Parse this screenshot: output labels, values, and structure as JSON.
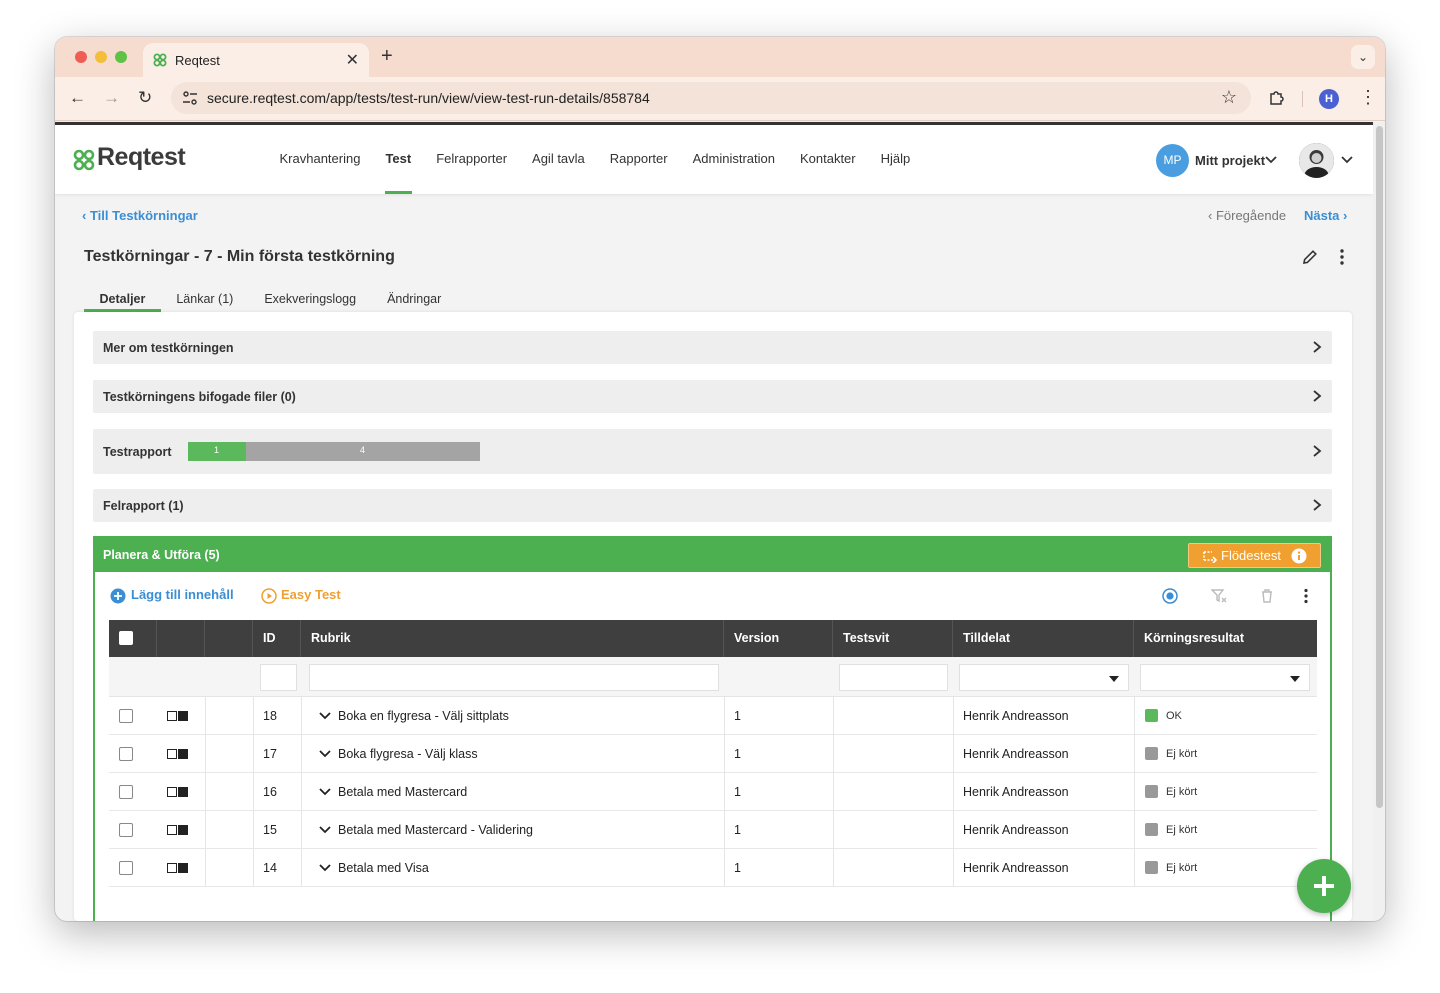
{
  "browser": {
    "tab_title": "Reqtest",
    "url": "secure.reqtest.com/app/tests/test-run/view/view-test-run-details/858784",
    "profile_initial": "H"
  },
  "app": {
    "logo_text": "Reqtest",
    "nav": [
      "Kravhantering",
      "Test",
      "Felrapporter",
      "Agil tavla",
      "Rapporter",
      "Administration",
      "Kontakter",
      "Hjälp"
    ],
    "active_nav": "Test",
    "project_initials": "MP",
    "project_label": "Mitt projekt"
  },
  "crumbs": {
    "back": "Till Testkörningar",
    "prev": "Föregående",
    "next": "Nästa"
  },
  "page": {
    "title": "Testkörningar - 7 - Min första testkörning",
    "subtabs": [
      "Detaljer",
      "Länkar (1)",
      "Exekveringslogg",
      "Ändringar"
    ],
    "active_subtab": "Detaljer"
  },
  "sections": {
    "more": "Mer om testkörningen",
    "files": "Testkörningens bifogade filer (0)",
    "report": "Testrapport",
    "report_pass": "1",
    "report_rest": "4",
    "report_pass_fraction": 0.2,
    "bugs": "Felrapport (1)"
  },
  "plan": {
    "title": "Planera & Utföra (5)",
    "flow_button": "Flödestest",
    "add_content": "Lägg till innehåll",
    "easy_test": "Easy Test",
    "columns": [
      "ID",
      "Rubrik",
      "Version",
      "Testsvit",
      "Tilldelat",
      "Körningsresultat"
    ],
    "rows": [
      {
        "id": "18",
        "title": "Boka en flygresa - Välj sittplats",
        "version": "1",
        "suite": "",
        "assignee": "Henrik Andreasson",
        "result": "OK",
        "result_color": "#5cb85c"
      },
      {
        "id": "17",
        "title": "Boka flygresa - Välj klass",
        "version": "1",
        "suite": "",
        "assignee": "Henrik Andreasson",
        "result": "Ej kört",
        "result_color": "#999999"
      },
      {
        "id": "16",
        "title": "Betala med Mastercard",
        "version": "1",
        "suite": "",
        "assignee": "Henrik Andreasson",
        "result": "Ej kört",
        "result_color": "#999999"
      },
      {
        "id": "15",
        "title": "Betala med Mastercard - Validering",
        "version": "1",
        "suite": "",
        "assignee": "Henrik Andreasson",
        "result": "Ej kört",
        "result_color": "#999999"
      },
      {
        "id": "14",
        "title": "Betala med Visa",
        "version": "1",
        "suite": "",
        "assignee": "Henrik Andreasson",
        "result": "Ej kört",
        "result_color": "#999999"
      }
    ]
  },
  "colors": {
    "accent_green": "#4caf50",
    "link_blue": "#3a8ed4",
    "orange": "#f0a030",
    "header_dark": "#3f3f3f"
  },
  "icons": {
    "logo": "reqtest-logo-icon",
    "edit": "pencil-icon",
    "more": "vertical-dots-icon",
    "chevron": "chevron-right-icon",
    "add": "plus-icon"
  }
}
